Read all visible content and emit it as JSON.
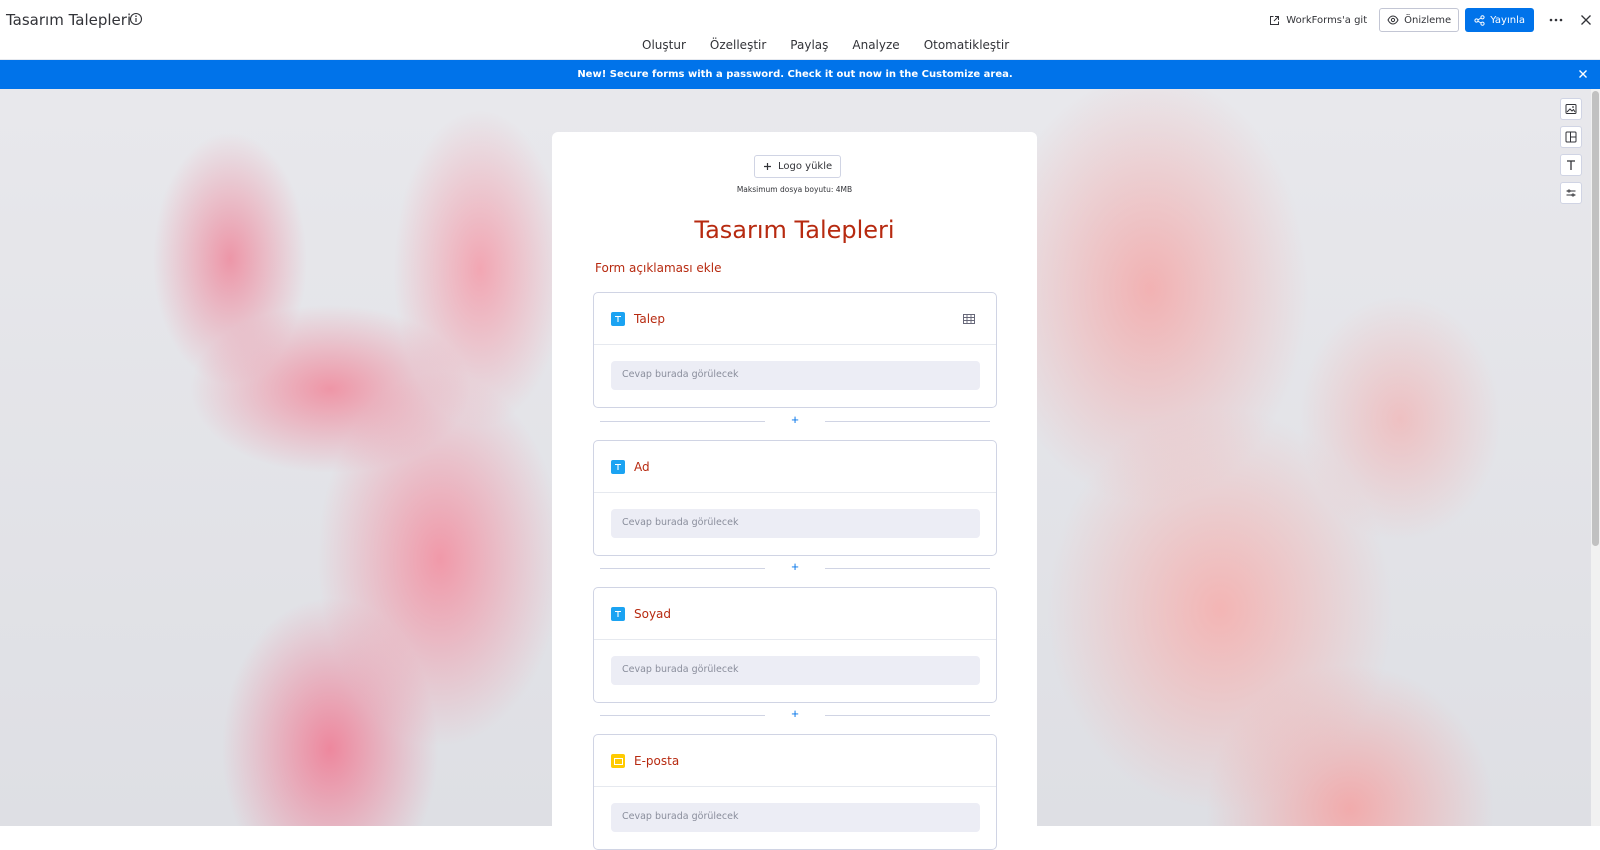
{
  "header": {
    "title": "Tasarım Talepleri",
    "tabs": [
      {
        "label": "Oluştur",
        "active": true
      },
      {
        "label": "Özelleştir",
        "active": false
      },
      {
        "label": "Paylaş",
        "active": false
      },
      {
        "label": "Analyze",
        "active": false
      },
      {
        "label": "Otomatikleştir",
        "active": false
      }
    ],
    "goto_label": "WorkForms'a git",
    "preview_label": "Önizleme",
    "publish_label": "Yayınla"
  },
  "banner": {
    "text": "New! Secure forms with a password. Check it out now in the Customize area."
  },
  "form": {
    "logo_button": "Logo yükle",
    "logo_hint": "Maksimum dosya boyutu: 4MB",
    "title": "Tasarım Talepleri",
    "description_placeholder": "Form açıklaması ekle",
    "add_symbol": "+",
    "questions": [
      {
        "label": "Talep",
        "type": "text",
        "answer_placeholder": "Cevap burada görülecek"
      },
      {
        "label": "Ad",
        "type": "text",
        "answer_placeholder": "Cevap burada görülecek"
      },
      {
        "label": "Soyad",
        "type": "text",
        "answer_placeholder": "Cevap burada görülecek"
      },
      {
        "label": "E-posta",
        "type": "email",
        "answer_placeholder": "Cevap burada görülecek"
      }
    ]
  },
  "colors": {
    "accent": "#0073ea",
    "form_text": "#b72a10",
    "text_icon_bg": "#1ba3f2",
    "email_icon_bg": "#ffcb00"
  }
}
